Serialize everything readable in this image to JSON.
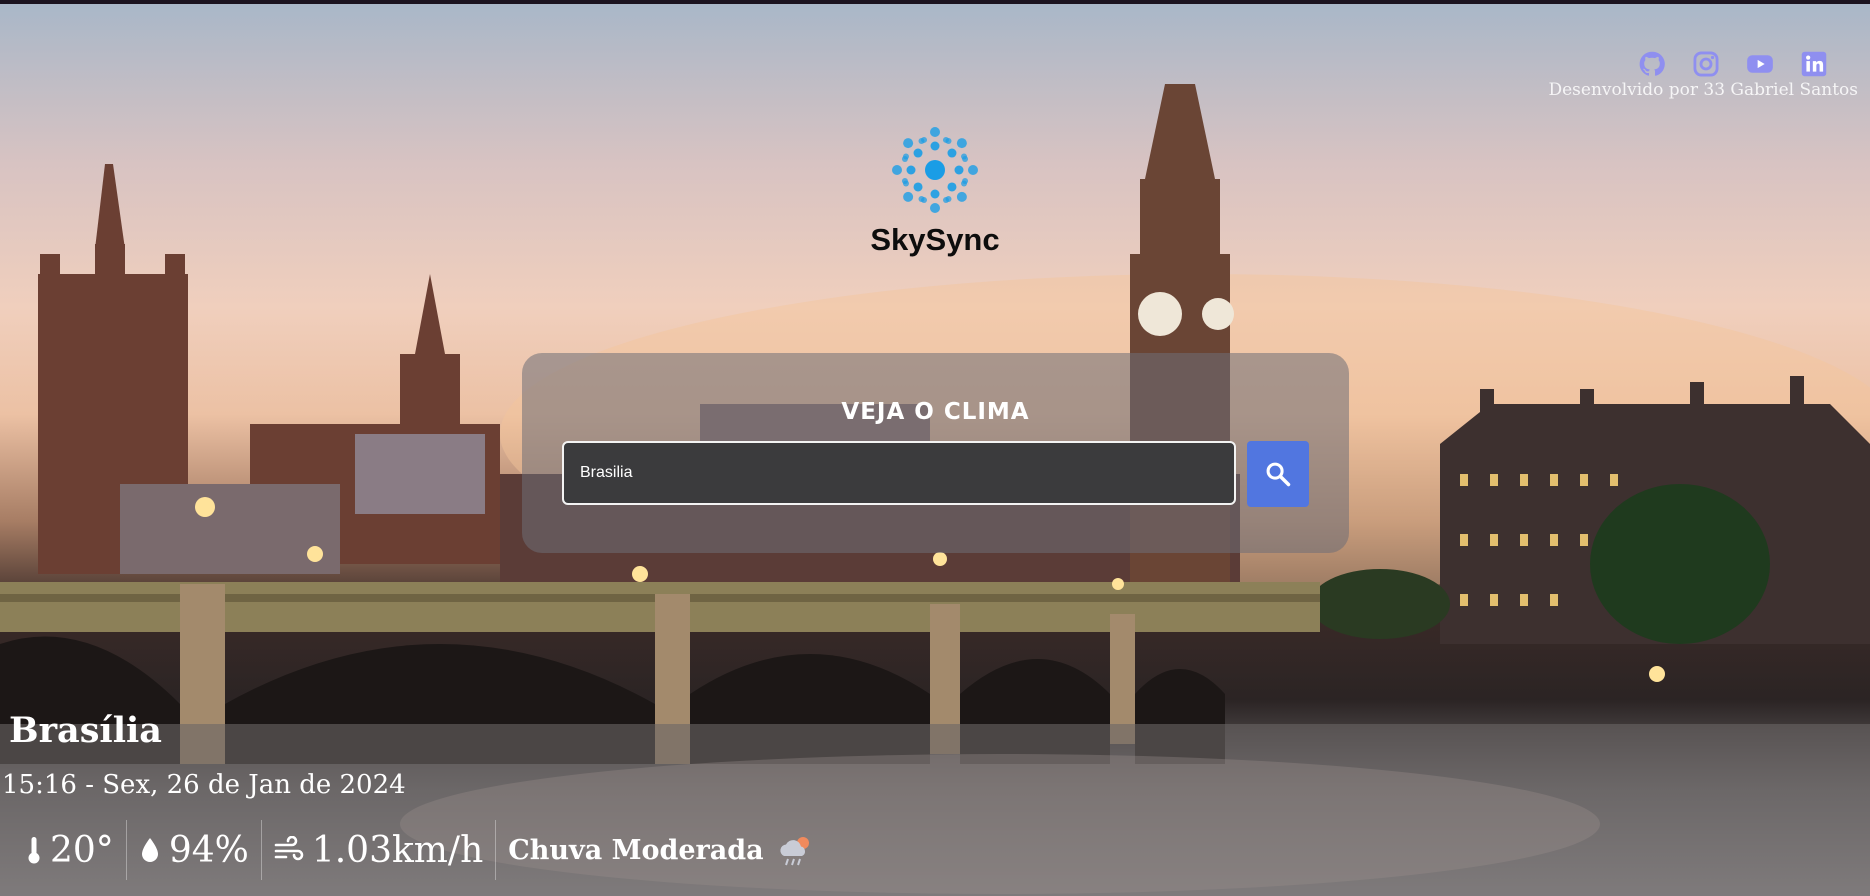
{
  "social": {
    "icons": [
      "github-icon",
      "instagram-icon",
      "youtube-icon",
      "linkedin-icon"
    ],
    "color": "#8f8ff0",
    "developer_text": "Desenvolvido por 33 Gabriel Santos"
  },
  "brand": {
    "name": "SkySync",
    "icon": "snowflake-dots-icon",
    "accent": "#1a9de6"
  },
  "search": {
    "title": "VEJA O CLIMA",
    "value": "Brasilia",
    "placeholder": "Digite a cidade",
    "button_icon": "search-icon",
    "button_color": "#5176e0"
  },
  "weather": {
    "city": "Brasília",
    "datetime": "15:16 - Sex, 26 de Jan de 2024",
    "temperature": "20°",
    "humidity": "94%",
    "wind": "1.03km/h",
    "condition": "Chuva Moderada",
    "condition_icon": "rain-cloud-icon"
  }
}
